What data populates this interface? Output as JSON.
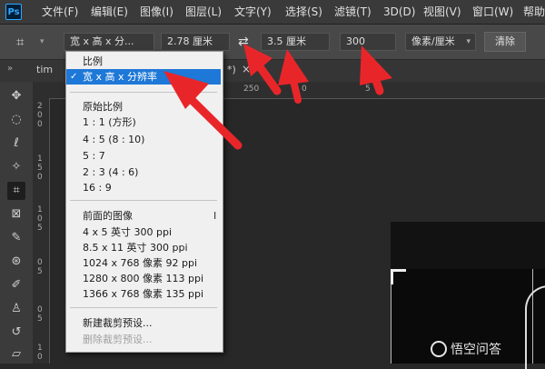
{
  "menubar": {
    "logo": "Ps",
    "items": [
      "文件(F)",
      "编辑(E)",
      "图像(I)",
      "图层(L)",
      "文字(Y)",
      "选择(S)",
      "滤镜(T)",
      "3D(D)",
      "视图(V)",
      "窗口(W)",
      "帮助"
    ]
  },
  "optionsbar": {
    "preset_select": "宽 x 高 x 分...",
    "width_value": "2.78 厘米",
    "height_value": "3.5 厘米",
    "resolution_value": "300",
    "unit_select": "像素/厘米",
    "clear_button": "清除"
  },
  "tabs": {
    "doc_tab_prefix": "tim",
    "doc_tab_suffix": "*)",
    "close": "×"
  },
  "ruler": {
    "top_ticks": [
      "250",
      "0",
      "5"
    ],
    "left_ticks": [
      "2",
      "0",
      "0",
      "1",
      "5",
      "0",
      "1",
      "0",
      "5",
      "0",
      "5",
      "0",
      "5",
      "1",
      "0"
    ]
  },
  "dropdown": {
    "items_group1": [
      "比例",
      "宽 x 高 x 分辨率"
    ],
    "selected_index": 1,
    "items_group2": [
      "原始比例",
      "1 : 1 (方形)",
      "4 : 5 (8 : 10)",
      "5 : 7",
      "2 : 3 (4 : 6)",
      "16 : 9"
    ],
    "items_group3": [
      "前面的图像",
      "4 x 5 英寸 300 ppi",
      "8.5 x 11 英寸 300 ppi",
      "1024 x 768 像素 92 ppi",
      "1280 x 800 像素 113 ppi",
      "1366 x 768 像素 135 ppi"
    ],
    "items_group4": [
      "新建裁剪预设...",
      "删除裁剪预设..."
    ],
    "cursor_glyph": "I"
  },
  "watermark": "悟空问答",
  "colors": {
    "arrow": "#e8262a",
    "selection": "#1e78d7",
    "ps_blue": "#31a8ff"
  }
}
